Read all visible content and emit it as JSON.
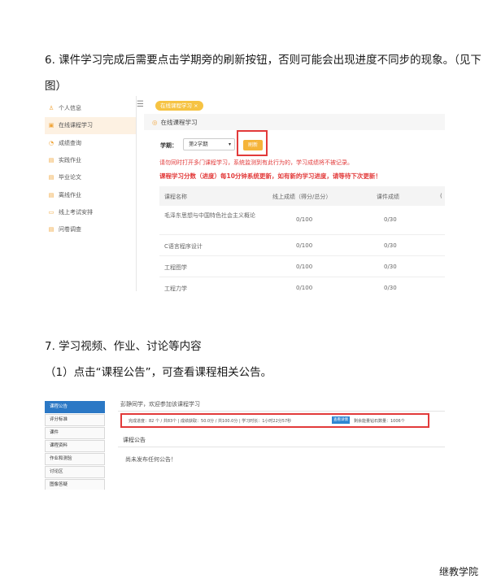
{
  "section6": {
    "line1": "6. 课件学习完成后需要点击学期旁的刷新按钮，否则可能会出现进度不同步的现象。（见下",
    "line2": "图）"
  },
  "shot1": {
    "sidebar": [
      {
        "label": "个人信息",
        "icon": "user-icon",
        "glyph": "♙",
        "active": false
      },
      {
        "label": "在线课程学习",
        "icon": "book-icon",
        "glyph": "▣",
        "active": true
      },
      {
        "label": "成绩查询",
        "icon": "chart-icon",
        "glyph": "◔",
        "active": false
      },
      {
        "label": "实践作业",
        "icon": "clipboard-icon",
        "glyph": "▤",
        "active": false
      },
      {
        "label": "毕业论文",
        "icon": "document-icon",
        "glyph": "▤",
        "active": false
      },
      {
        "label": "离线作业",
        "icon": "file-icon",
        "glyph": "▤",
        "active": false
      },
      {
        "label": "线上考试安排",
        "icon": "monitor-icon",
        "glyph": "▭",
        "active": false
      },
      {
        "label": "问卷调查",
        "icon": "survey-icon",
        "glyph": "▤",
        "active": false
      }
    ],
    "menu_glyph": "☰",
    "tab_label": "在线课程学习 ×",
    "title_dot": "◎",
    "title": "在线课程学习",
    "term_label": "学期：",
    "term_selected": "第2学期",
    "term_caret": "▾",
    "refresh_label": "刷新",
    "warning": "请勿同时打开多门课程学习，系统监测到有此行为的，学习成绩将不被记录。",
    "notice": "课程学习分数（进度）每10分钟系统更新，如有新的学习进度，请等待下次更新！",
    "table": {
      "headers": [
        "课程名称",
        "线上成绩（得分/总分）",
        "课件成绩",
        "("
      ],
      "rows": [
        {
          "name": "毛泽东思想与中国特色社会主义概论",
          "online": "0/100",
          "courseware": "0/30"
        },
        {
          "name": "C语言程序设计",
          "online": "0/100",
          "courseware": "0/30"
        },
        {
          "name": "工程图学",
          "online": "0/100",
          "courseware": "0/30"
        },
        {
          "name": "工程力学",
          "online": "0/100",
          "courseware": "0/30"
        }
      ]
    }
  },
  "section7": {
    "heading": "7. 学习视频、作业、讨论等内容",
    "sub1": "（1）点击“课程公告”，可查看课程相关公告。"
  },
  "shot2": {
    "nav": [
      {
        "label": "课程公告",
        "active": true
      },
      {
        "label": "评分标准",
        "active": false
      },
      {
        "label": "课件",
        "active": false
      },
      {
        "label": "课程资料",
        "active": false
      },
      {
        "label": "作业和测验",
        "active": false
      },
      {
        "label": "讨论区",
        "active": false
      },
      {
        "label": "图像答疑",
        "active": false
      }
    ],
    "welcome": "彭静同学，欢迎参加该课程学习",
    "progress": "完成进度：82 个 / 共83个  |  成绩获取：50.0分 / 共100.0分  |  学习时长：1小时22分57秒",
    "detail_button": "查看详情",
    "diamonds": "剩余能量钻石数量：1006个",
    "section_title": "课程公告",
    "empty_text": "尚未发布任何公告！"
  },
  "watermark": "继教学院"
}
